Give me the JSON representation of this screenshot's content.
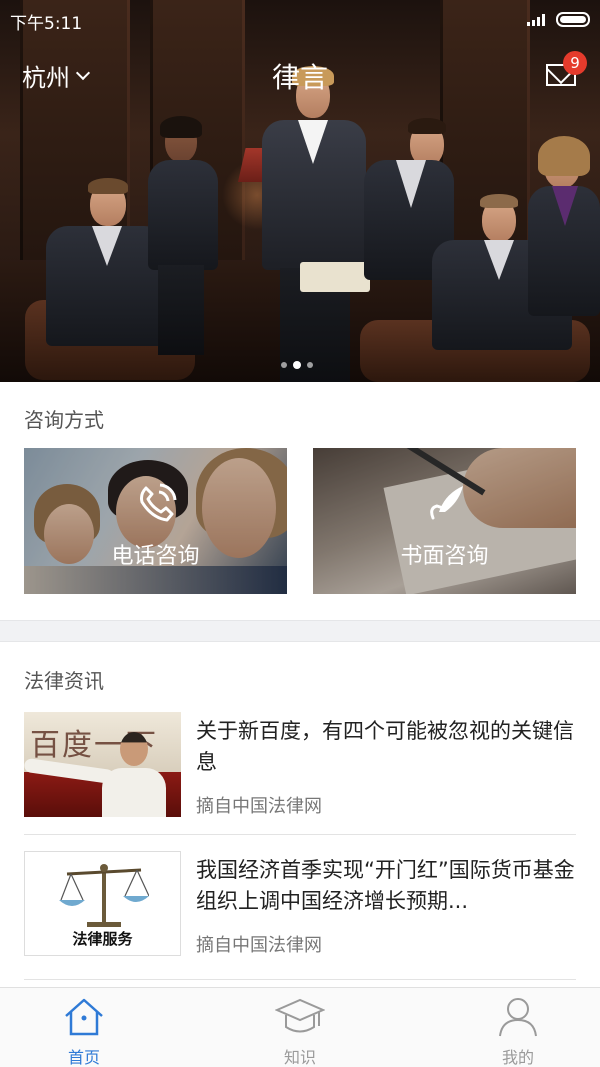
{
  "status_bar": {
    "time": "下午5:11"
  },
  "header": {
    "city": "杭州",
    "title": "律言",
    "unread_count": "9"
  },
  "banner": {
    "slides": 3,
    "active_slide": 2
  },
  "consult": {
    "section_title": "咨询方式",
    "options": [
      {
        "label": "电话咨询",
        "icon": "phone-icon"
      },
      {
        "label": "书面咨询",
        "icon": "feather-pen-icon"
      }
    ]
  },
  "news": {
    "section_title": "法律资讯",
    "items": [
      {
        "title": "关于新百度，有四个可能被忽视的关键信息",
        "source": "摘自中国法律网",
        "thumb_text": "百度一下"
      },
      {
        "title": "我国经济首季实现“开门红”国际货币基金组织上调中国经济增长预期...",
        "source": "摘自中国法律网",
        "thumb_text": "法律服务"
      }
    ]
  },
  "tabbar": {
    "tabs": [
      {
        "label": "首页",
        "icon": "home-icon",
        "active": true
      },
      {
        "label": "知识",
        "icon": "graduation-cap-icon",
        "active": false
      },
      {
        "label": "我的",
        "icon": "user-icon",
        "active": false
      }
    ]
  },
  "colors": {
    "accent": "#2f7ad6",
    "badge": "#e53b2c",
    "tab_inactive": "#9a9a9a"
  }
}
